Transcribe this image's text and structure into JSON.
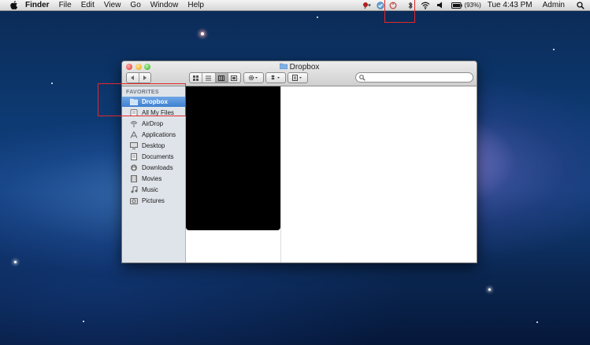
{
  "menubar": {
    "app_name": "Finder",
    "menus": [
      "File",
      "Edit",
      "View",
      "Go",
      "Window",
      "Help"
    ],
    "battery": "(93%)",
    "clock": "Tue 4:43 PM",
    "user": "Admin"
  },
  "window": {
    "title": "Dropbox",
    "search_placeholder": ""
  },
  "sidebar": {
    "section_header": "FAVORITES",
    "items": [
      {
        "label": "Dropbox",
        "icon": "dropbox-folder-icon",
        "selected": true
      },
      {
        "label": "All My Files",
        "icon": "all-files-icon"
      },
      {
        "label": "AirDrop",
        "icon": "airdrop-icon"
      },
      {
        "label": "Applications",
        "icon": "applications-icon"
      },
      {
        "label": "Desktop",
        "icon": "desktop-icon"
      },
      {
        "label": "Documents",
        "icon": "documents-icon"
      },
      {
        "label": "Downloads",
        "icon": "downloads-icon"
      },
      {
        "label": "Movies",
        "icon": "movies-icon"
      },
      {
        "label": "Music",
        "icon": "music-icon"
      },
      {
        "label": "Pictures",
        "icon": "pictures-icon"
      }
    ]
  },
  "colors": {
    "selection": "#3f7fd0",
    "highlight_box": "#e0282a",
    "close": "#ef5b56",
    "minimize": "#f6bd3f",
    "zoom": "#5fc94a"
  }
}
